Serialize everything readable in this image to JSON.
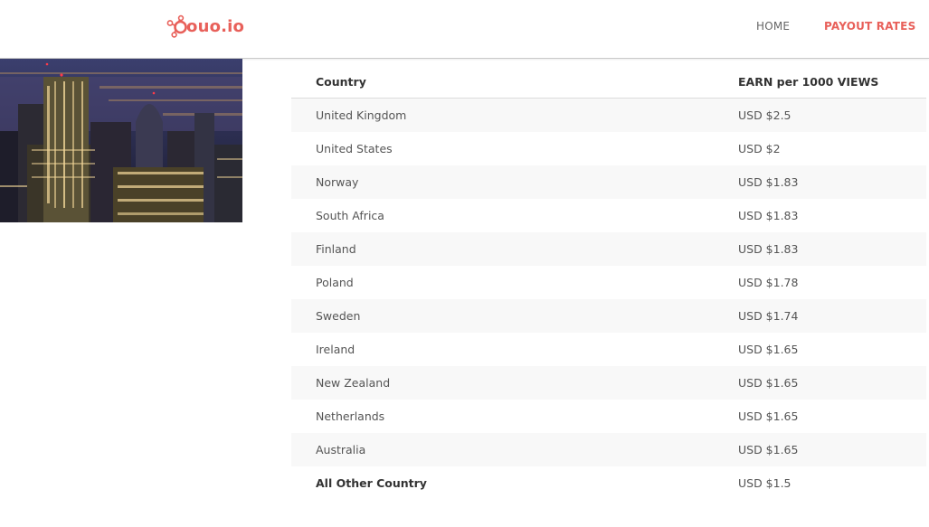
{
  "brand": {
    "name": "ouo.io",
    "color": "#e8605a",
    "logo_icon": "molecule-nodes-icon"
  },
  "nav": {
    "items": [
      {
        "label": "HOME",
        "active": false
      },
      {
        "label": "PAYOUT RATES",
        "active": true
      }
    ]
  },
  "hero_image": {
    "subject": "city-skyline-at-night"
  },
  "rates_table": {
    "headers": [
      "Country",
      "EARN per 1000 VIEWS"
    ],
    "rows": [
      {
        "country": "United Kingdom",
        "rate": "USD $2.5"
      },
      {
        "country": "United States",
        "rate": "USD $2"
      },
      {
        "country": "Norway",
        "rate": "USD $1.83"
      },
      {
        "country": "South Africa",
        "rate": "USD $1.83"
      },
      {
        "country": "Finland",
        "rate": "USD $1.83"
      },
      {
        "country": "Poland",
        "rate": "USD $1.78"
      },
      {
        "country": "Sweden",
        "rate": "USD $1.74"
      },
      {
        "country": "Ireland",
        "rate": "USD $1.65"
      },
      {
        "country": "New Zealand",
        "rate": "USD $1.65"
      },
      {
        "country": "Netherlands",
        "rate": "USD $1.65"
      },
      {
        "country": "Australia",
        "rate": "USD $1.65"
      },
      {
        "country": "All Other Country",
        "rate": "USD $1.5"
      }
    ]
  }
}
